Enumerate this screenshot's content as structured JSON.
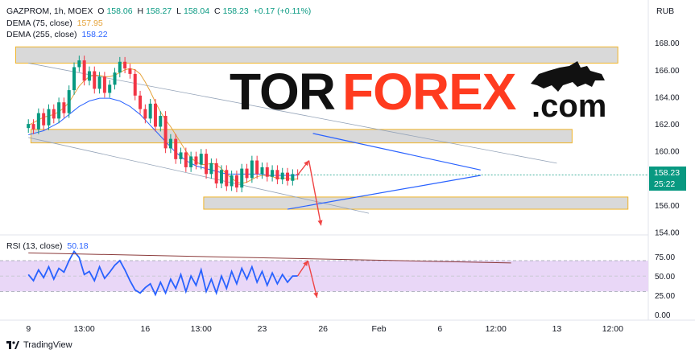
{
  "header": {
    "symbol": "GAZPROM, 1h, MOEX",
    "open_label": "O",
    "open": "158.06",
    "high_label": "H",
    "high": "158.27",
    "low_label": "L",
    "low": "158.04",
    "close_label": "C",
    "close": "158.23",
    "change": "+0.17 (+0.11%)",
    "dema75_label": "DEMA (75, close)",
    "dema75_value": "157.95",
    "dema255_label": "DEMA (255, close)",
    "dema255_value": "158.22",
    "rsi_label": "RSI (13, close)",
    "rsi_value": "50.18"
  },
  "currency": "RUB",
  "last_price": "158.23",
  "countdown": "25:22",
  "logo": {
    "part1": "TOR",
    "part2": "FOREX",
    "part3": ".com"
  },
  "footer": {
    "brand": "TradingView"
  },
  "colors": {
    "up": "#089981",
    "down": "#f23645",
    "dema75": "#e5a33a",
    "dema255": "#2962ff",
    "rsi_band": "#e9d7f7",
    "zone": "#d9d9d9",
    "zone_border": "#f0b429",
    "logo_red": "#ff3b1f"
  },
  "chart_data": [
    {
      "type": "line",
      "title": "",
      "price_axis": {
        "ticks": [
          154,
          156,
          158,
          160,
          162,
          164,
          166,
          168
        ],
        "tick_labels": [
          "154.00",
          "156.00",
          "158.00",
          "160.00",
          "162.00",
          "164.00",
          "166.00",
          "168.00"
        ],
        "ylim": [
          153.8,
          169.5
        ]
      },
      "time_axis": {
        "tick_labels": [
          "9",
          "13:00",
          "16",
          "13:00",
          "23",
          "26",
          "Feb",
          "6",
          "12:00",
          "13",
          "12:00"
        ],
        "tick_pos": [
          0,
          11,
          23,
          34,
          46,
          58,
          69,
          81,
          92,
          104,
          115
        ],
        "xlim": [
          -4,
          122
        ]
      },
      "series": [
        {
          "name": "DEMA (75, close)",
          "values": [
            161.9,
            162.1,
            162.3,
            162.5,
            162.6,
            162.7,
            162.9,
            163.2,
            163.6,
            164.2,
            164.8,
            165.2,
            165.5,
            165.6,
            165.6,
            165.5,
            165.5,
            165.6,
            165.8,
            166.0,
            166.1,
            166.0,
            165.7,
            165.1,
            164.4,
            163.6,
            162.9,
            162.3,
            161.8,
            161.2,
            160.6,
            160.0,
            159.5,
            159.2,
            159.0,
            159.0,
            159.1,
            159.0,
            158.7,
            158.3,
            158.0,
            157.7,
            157.6,
            157.7,
            157.9,
            158.1,
            158.2,
            158.2,
            158.1,
            158.0,
            158.0,
            158.0,
            157.9,
            157.95
          ]
        },
        {
          "name": "DEMA (255, close)",
          "values": [
            161.2,
            161.3,
            161.4,
            161.5,
            161.7,
            161.9,
            162.1,
            162.4,
            162.7,
            163.0,
            163.3,
            163.5,
            163.7,
            163.8,
            163.9,
            163.9,
            163.9,
            163.8,
            163.7,
            163.5,
            163.3,
            163.0,
            162.7,
            162.3,
            161.9,
            161.5,
            161.1,
            160.7,
            160.3,
            159.9,
            159.6,
            159.3,
            159.1,
            158.9,
            158.8,
            158.7,
            158.6,
            158.5,
            158.4,
            158.3,
            158.3,
            158.3,
            158.3,
            158.3,
            158.3,
            158.3,
            158.3,
            158.2,
            158.2,
            158.2,
            158.2,
            158.2,
            158.2,
            158.22
          ]
        },
        {
          "name": "GAZPROM",
          "values": [
            162.0,
            161.6,
            162.8,
            161.9,
            163.1,
            162.4,
            163.6,
            162.8,
            164.5,
            166.2,
            166.7,
            165.2,
            165.9,
            164.6,
            165.5,
            164.3,
            164.9,
            165.8,
            166.6,
            166.1,
            165.7,
            164.1,
            163.1,
            162.4,
            163.5,
            161.8,
            162.6,
            160.2,
            160.9,
            159.4,
            159.9,
            158.8,
            159.6,
            159.0,
            159.8,
            158.3,
            159.1,
            157.6,
            158.6,
            157.4,
            158.2,
            157.3,
            158.7,
            158.0,
            159.3,
            158.3,
            158.8,
            158.1,
            158.6,
            157.9,
            158.4,
            157.8,
            158.3,
            158.23
          ]
        }
      ]
    },
    {
      "type": "line",
      "title": "",
      "axis": {
        "ticks": [
          0,
          25,
          50,
          75
        ],
        "tick_labels": [
          "0.00",
          "25.00",
          "50.00",
          "75.00"
        ],
        "ylim": [
          -4,
          95
        ],
        "band": [
          30,
          70
        ]
      },
      "series": [
        {
          "name": "RSI (13, close)",
          "values": [
            52,
            44,
            58,
            48,
            62,
            46,
            60,
            55,
            70,
            82,
            74,
            52,
            56,
            44,
            62,
            47,
            55,
            64,
            70,
            58,
            44,
            32,
            28,
            35,
            40,
            26,
            42,
            28,
            46,
            34,
            52,
            30,
            50,
            38,
            58,
            30,
            46,
            28,
            50,
            34,
            56,
            40,
            60,
            46,
            62,
            42,
            56,
            38,
            54,
            40,
            52,
            42,
            50,
            50.18
          ]
        }
      ]
    }
  ]
}
